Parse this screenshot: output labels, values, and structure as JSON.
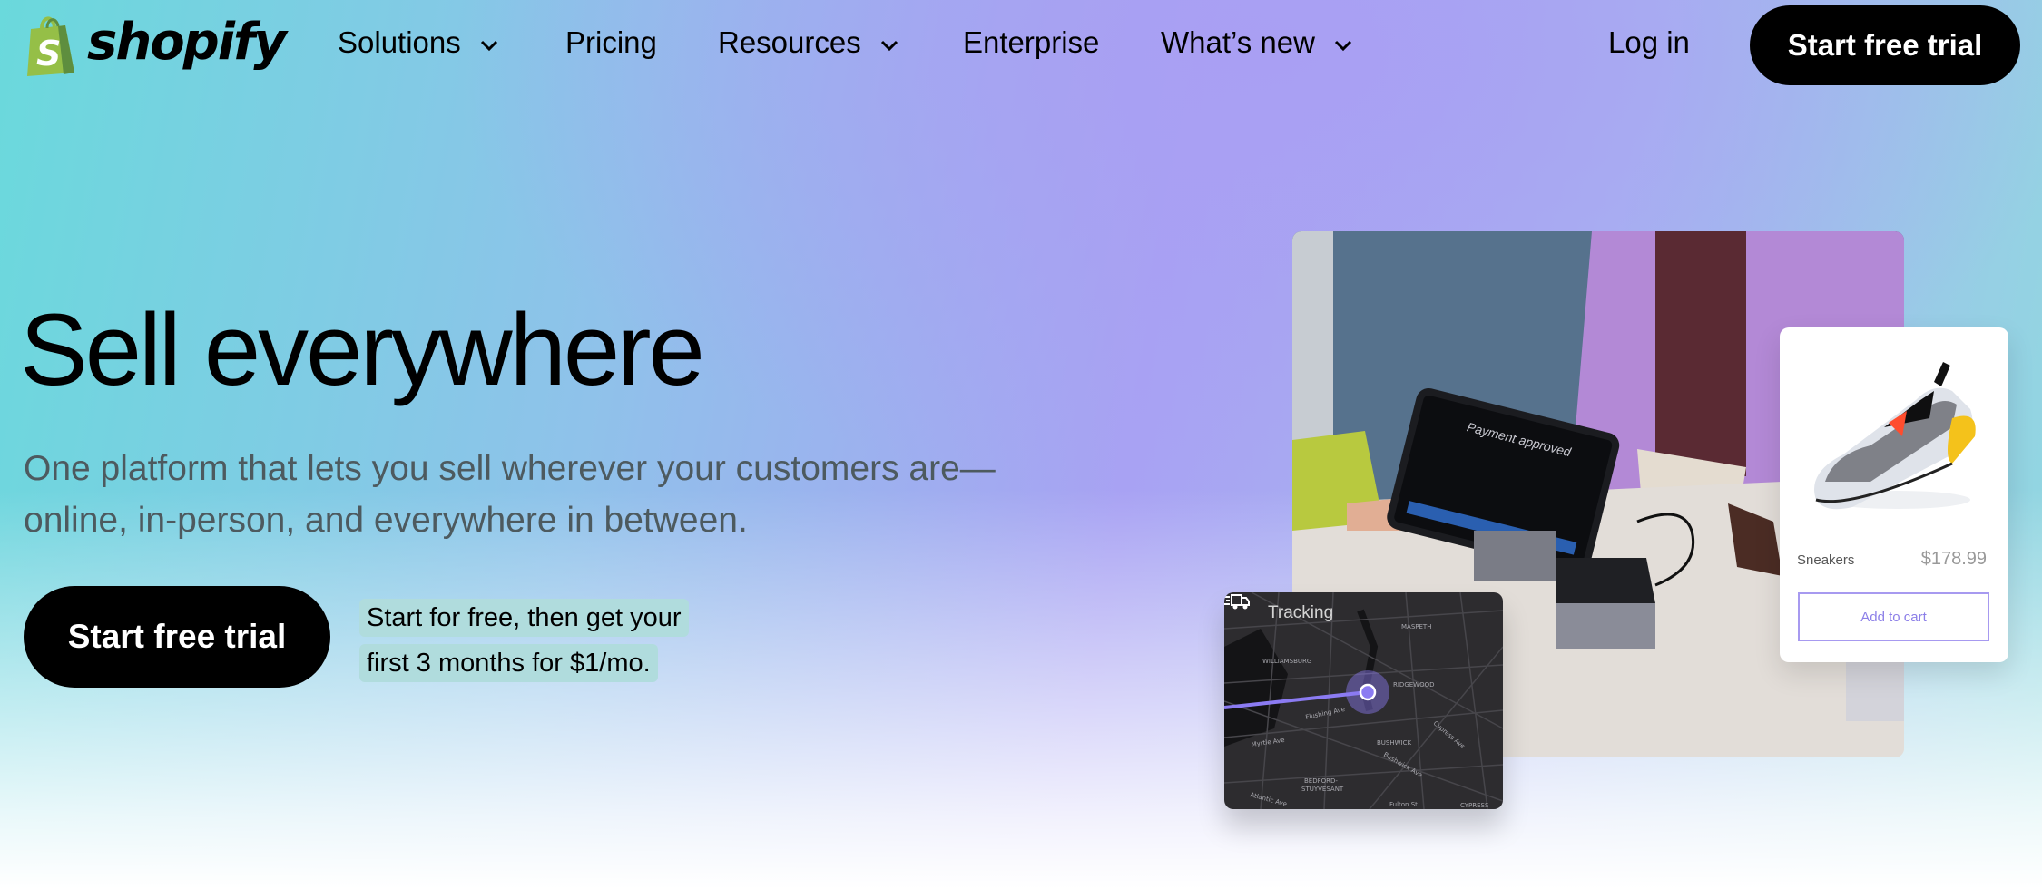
{
  "brand": {
    "name": "shopify",
    "bag_color": "#95bf47",
    "bag_dark": "#5e8e3e"
  },
  "nav": {
    "items": [
      {
        "label": "Solutions",
        "has_dropdown": true
      },
      {
        "label": "Pricing",
        "has_dropdown": false
      },
      {
        "label": "Resources",
        "has_dropdown": true
      },
      {
        "label": "Enterprise",
        "has_dropdown": false
      },
      {
        "label": "What’s new",
        "has_dropdown": true
      }
    ],
    "login_label": "Log in",
    "cta_label": "Start free trial"
  },
  "hero": {
    "title": "Sell everywhere",
    "subtitle": "One platform that lets you sell wherever your customers are—online, in-person, and everywhere in between.",
    "cta_label": "Start free trial",
    "promo_lines": [
      "Start for free, then get your",
      "first 3 months for $1/mo."
    ]
  },
  "media": {
    "pos_screen_text": "Payment approved",
    "tracking": {
      "label": "Tracking",
      "map_labels": [
        "MASPETH",
        "WILLIAMSBURG",
        "RIDGEWOOD",
        "Flushing Ave",
        "Cypress Ave",
        "BUSHWICK",
        "Myrtle Ave",
        "Bushwick Ave",
        "BEDFORD-STUYVESANT",
        "Atlantic Ave",
        "Fulton St",
        "CYPRESS"
      ],
      "route_color": "#8b7bf2"
    },
    "product_card": {
      "name": "Sneakers",
      "price": "$178.99",
      "button_label": "Add to cart",
      "accent": "#8c7fe8"
    }
  }
}
